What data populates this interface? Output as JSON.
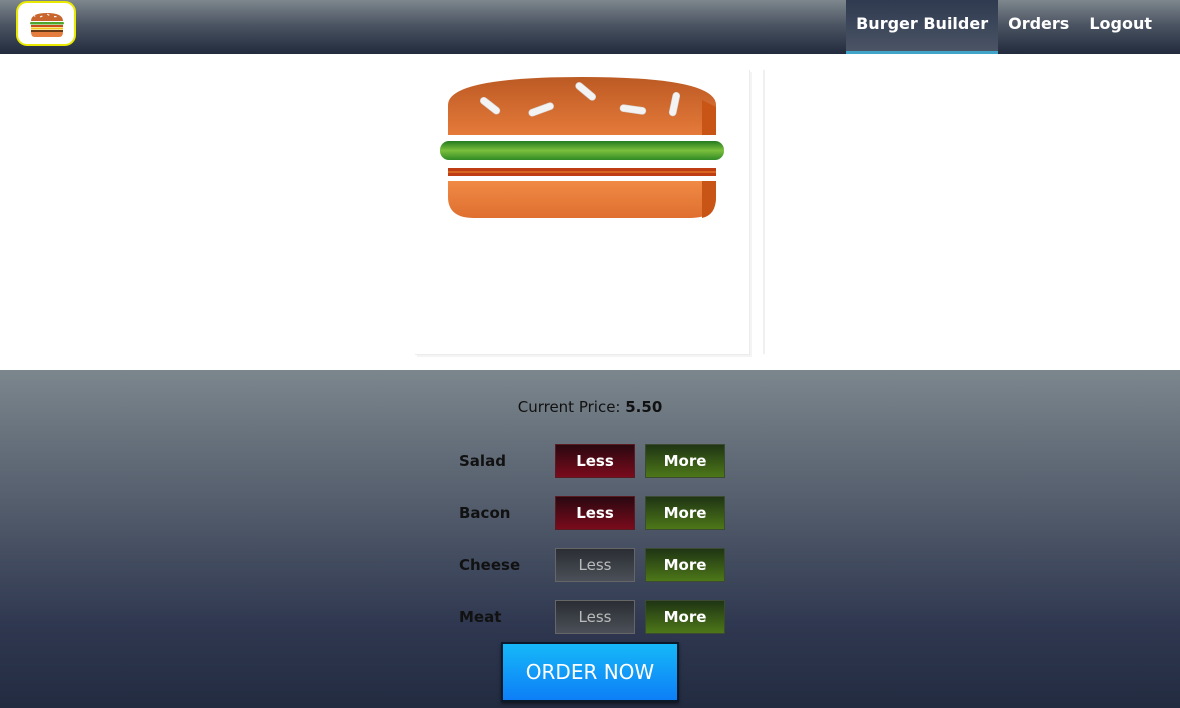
{
  "nav": {
    "items": [
      {
        "label": "Burger Builder",
        "active": true
      },
      {
        "label": "Orders",
        "active": false
      },
      {
        "label": "Logout",
        "active": false
      }
    ]
  },
  "price": {
    "label": "Current Price: ",
    "value": "5.50"
  },
  "controls": [
    {
      "label": "Salad",
      "less": "Less",
      "more": "More",
      "less_enabled": true
    },
    {
      "label": "Bacon",
      "less": "Less",
      "more": "More",
      "less_enabled": true
    },
    {
      "label": "Cheese",
      "less": "Less",
      "more": "More",
      "less_enabled": false
    },
    {
      "label": "Meat",
      "less": "Less",
      "more": "More",
      "less_enabled": false
    }
  ],
  "order_button": "ORDER NOW",
  "burger_layers": [
    "bread-top",
    "salad",
    "bacon",
    "bread-bottom"
  ],
  "colors": {
    "toolbar_top": "#7e878d",
    "toolbar_bottom": "#222b3d",
    "active_underline": "#40a4c8",
    "less_active": "#7a0b1c",
    "more": "#4d7718",
    "order": "#0d7ef7",
    "logo_border": "#e8e800"
  }
}
